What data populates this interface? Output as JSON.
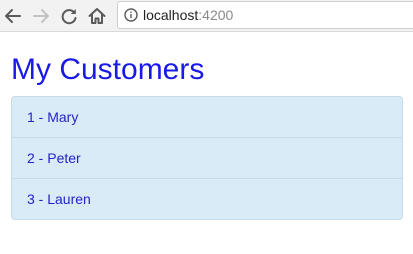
{
  "browser": {
    "url_host": "localhost",
    "url_port": ":4200",
    "icons": {
      "back": "arrow-left-icon",
      "forward": "arrow-right-icon",
      "reload": "reload-icon",
      "home": "home-icon",
      "info": "info-icon"
    }
  },
  "page": {
    "title": "My Customers",
    "customers": [
      {
        "label": "1 - Mary"
      },
      {
        "label": "2 - Peter"
      },
      {
        "label": "3 - Lauren"
      }
    ]
  },
  "colors": {
    "title": "#1a1ae6",
    "list_background": "#d9ebf6",
    "list_text": "#2323c8",
    "list_border": "#c5dbe9"
  }
}
